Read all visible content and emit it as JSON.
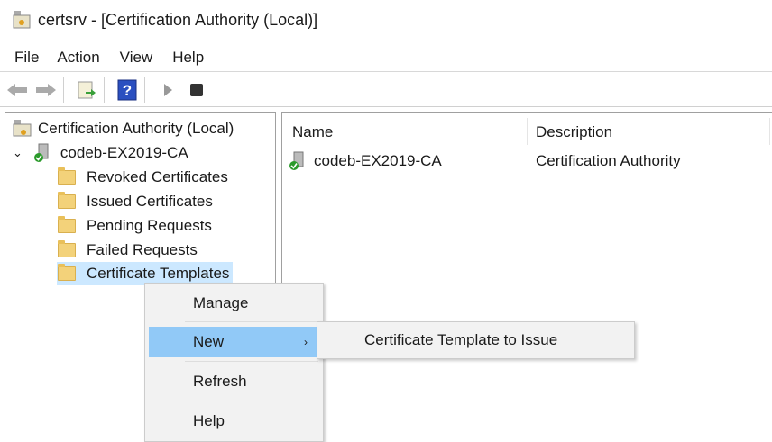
{
  "window": {
    "title": "certsrv - [Certification Authority (Local)]"
  },
  "menu": [
    "File",
    "Action",
    "View",
    "Help"
  ],
  "toolbar": {
    "icons": [
      "back-arrow-icon",
      "forward-arrow-icon",
      "export-list-icon",
      "help-icon",
      "start-service-icon",
      "stop-service-icon"
    ]
  },
  "tree": {
    "root": "Certification Authority (Local)",
    "ca": "codeb-EX2019-CA",
    "children": [
      "Revoked Certificates",
      "Issued Certificates",
      "Pending Requests",
      "Failed Requests",
      "Certificate Templates"
    ]
  },
  "list": {
    "columns": [
      "Name",
      "Description"
    ],
    "rows": [
      {
        "name": "codeb-EX2019-CA",
        "description": "Certification Authority"
      }
    ]
  },
  "context_menu": {
    "items": [
      "Manage",
      "New",
      "Refresh",
      "Help"
    ],
    "submenu": [
      "Certificate Template to Issue"
    ]
  },
  "colors": {
    "highlight": "#91c9f7",
    "selection": "#cce8ff"
  }
}
